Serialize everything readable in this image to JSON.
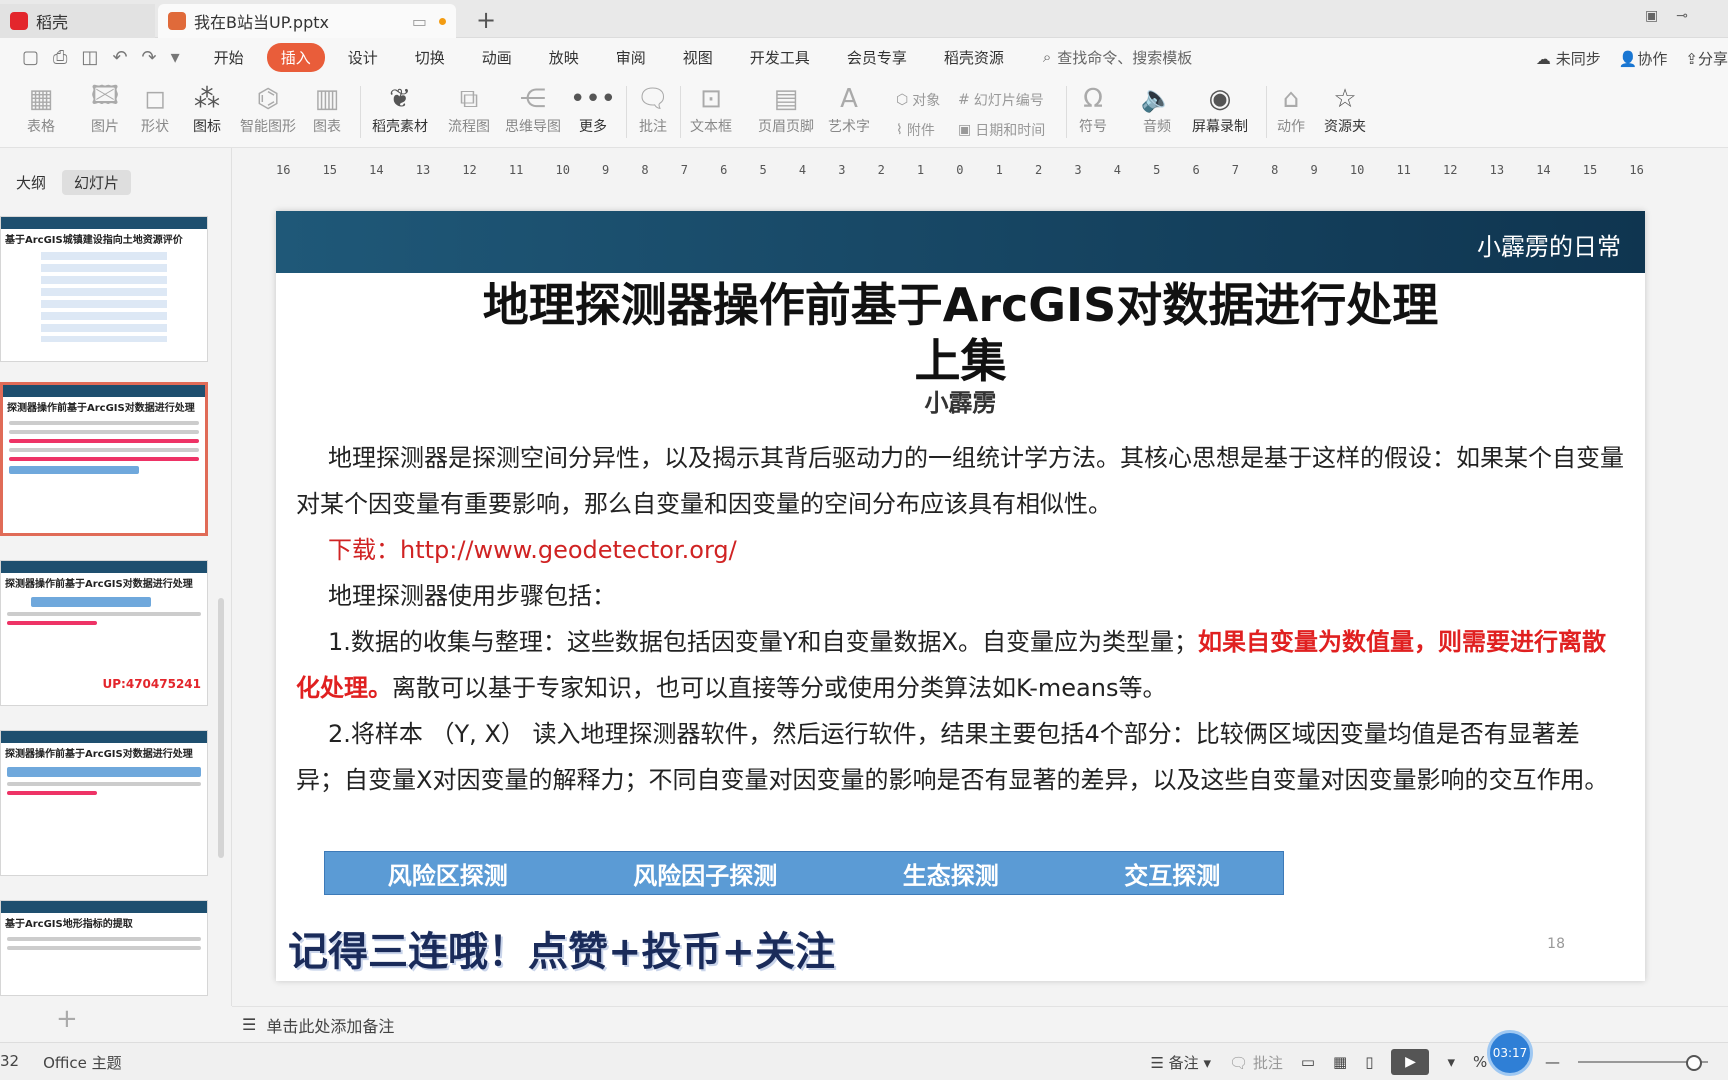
{
  "titlebar": {
    "app_tab": "稻壳",
    "doc_tab": "我在B站当UP.pptx",
    "new_tab": "+"
  },
  "menu": {
    "items": [
      "开始",
      "插入",
      "设计",
      "切换",
      "动画",
      "放映",
      "审阅",
      "视图",
      "开发工具",
      "会员专享",
      "稻壳资源"
    ],
    "active": "插入",
    "search_placeholder": "查找命令、搜索模板",
    "sync": "未同步",
    "collab": "协作",
    "share": "分享"
  },
  "toolbar": {
    "table": "表格",
    "picture": "图片",
    "shape": "形状",
    "icon": "图标",
    "smart": "智能图形",
    "chart": "图表",
    "material": "稻壳素材",
    "flow": "流程图",
    "mind": "思维导图",
    "more": "更多",
    "comment": "批注",
    "textbox": "文本框",
    "header": "页眉页脚",
    "wordart": "艺术字",
    "object": "对象",
    "slide_num": "幻灯片编号",
    "attach": "附件",
    "datetime": "日期和时间",
    "symbol": "符号",
    "audio": "音频",
    "screen_rec": "屏幕录制",
    "action": "动作",
    "resource": "资源夹"
  },
  "left_panel": {
    "tab_outline": "大纲",
    "tab_slides": "幻灯片",
    "thumb1_title": "基于ArcGIS城镇建设指向土地资源评价",
    "thumb2_title": "探测器操作前基于ArcGIS对数据进行处理",
    "thumb3_title": "探测器操作前基于ArcGIS对数据进行处理",
    "thumb3_up": "UP:470475241",
    "thumb4_title": "探测器操作前基于ArcGIS对数据进行处理",
    "thumb5_title": "基于ArcGIS地形指标的提取"
  },
  "ruler": [
    "16",
    "15",
    "14",
    "13",
    "12",
    "11",
    "10",
    "9",
    "8",
    "7",
    "6",
    "5",
    "4",
    "3",
    "2",
    "1",
    "0",
    "1",
    "2",
    "3",
    "4",
    "5",
    "6",
    "7",
    "8",
    "9",
    "10",
    "11",
    "12",
    "13",
    "14",
    "15",
    "16"
  ],
  "slide": {
    "header": "小霹雳的日常",
    "title_line1": "地理探测器操作前基于ArcGIS对数据进行处理",
    "title_line2": "上集",
    "author": "小霹雳",
    "para1": "地理探测器是探测空间分异性，以及揭示其背后驱动力的一组统计学方法。其核心思想是基于这样的假设：如果某个自变量对某个因变量有重要影响，那么自变量和因变量的空间分布应该具有相似性。",
    "download": "下载：http://www.geodetector.org/",
    "steps_intro": "地理探测器使用步骤包括：",
    "step1_a": "1.数据的收集与整理：这些数据包括因变量Y和自变量数据X。自变量应为类型量；",
    "step1_red": "如果自变量为数值量，则需要进行离散化处理。",
    "step1_b": "离散可以基于专家知识，也可以直接等分或使用分类算法如K-means等。",
    "step2": "2.将样本 （Y, X） 读入地理探测器软件，然后运行软件，结果主要包括4个部分：比较俩区域因变量均值是否有显著差异；自变量X对因变量的解释力；不同自变量对因变量的影响是否有显著的差异，以及这些自变量对因变量影响的交互作用。",
    "box1": "风险区探测",
    "box2": "风险因子探测",
    "box3": "生态探测",
    "box4": "交互探测",
    "cta": "记得三连哦！点赞+投币+关注",
    "page_number": "18"
  },
  "notes": {
    "placeholder": "单击此处添加备注"
  },
  "status": {
    "slide_count": "32",
    "theme": "Office 主题",
    "notes_btn": "备注",
    "comment_btn": "批注",
    "timer": "03:17",
    "zoom_suffix": "%"
  }
}
